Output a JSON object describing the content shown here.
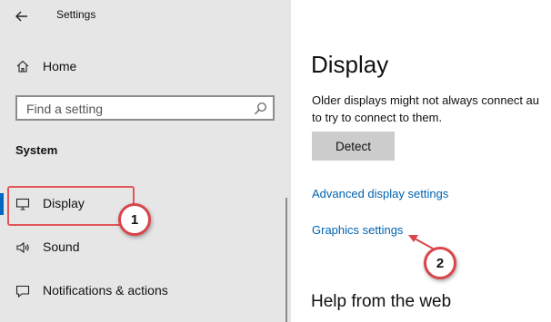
{
  "window": {
    "title": "Settings"
  },
  "sidebar": {
    "home_label": "Home",
    "search_placeholder": "Find a setting",
    "section_title": "System",
    "items": [
      {
        "label": "Display",
        "icon": "monitor-icon",
        "active": true
      },
      {
        "label": "Sound",
        "icon": "speaker-icon"
      },
      {
        "label": "Notifications & actions",
        "icon": "notification-icon"
      }
    ]
  },
  "main": {
    "title": "Display",
    "description_line1": "Older displays might not always connect au",
    "description_line2": "to try to connect to them.",
    "detect_button": "Detect",
    "links": [
      "Advanced display settings",
      "Graphics settings"
    ],
    "help_title": "Help from the web"
  },
  "annotations": {
    "marker1": "1",
    "marker2": "2",
    "highlight_color": "#e2565a"
  },
  "colors": {
    "accent": "#0067c0",
    "link": "#0063b1",
    "sidebar_bg": "#e6e6e6"
  }
}
